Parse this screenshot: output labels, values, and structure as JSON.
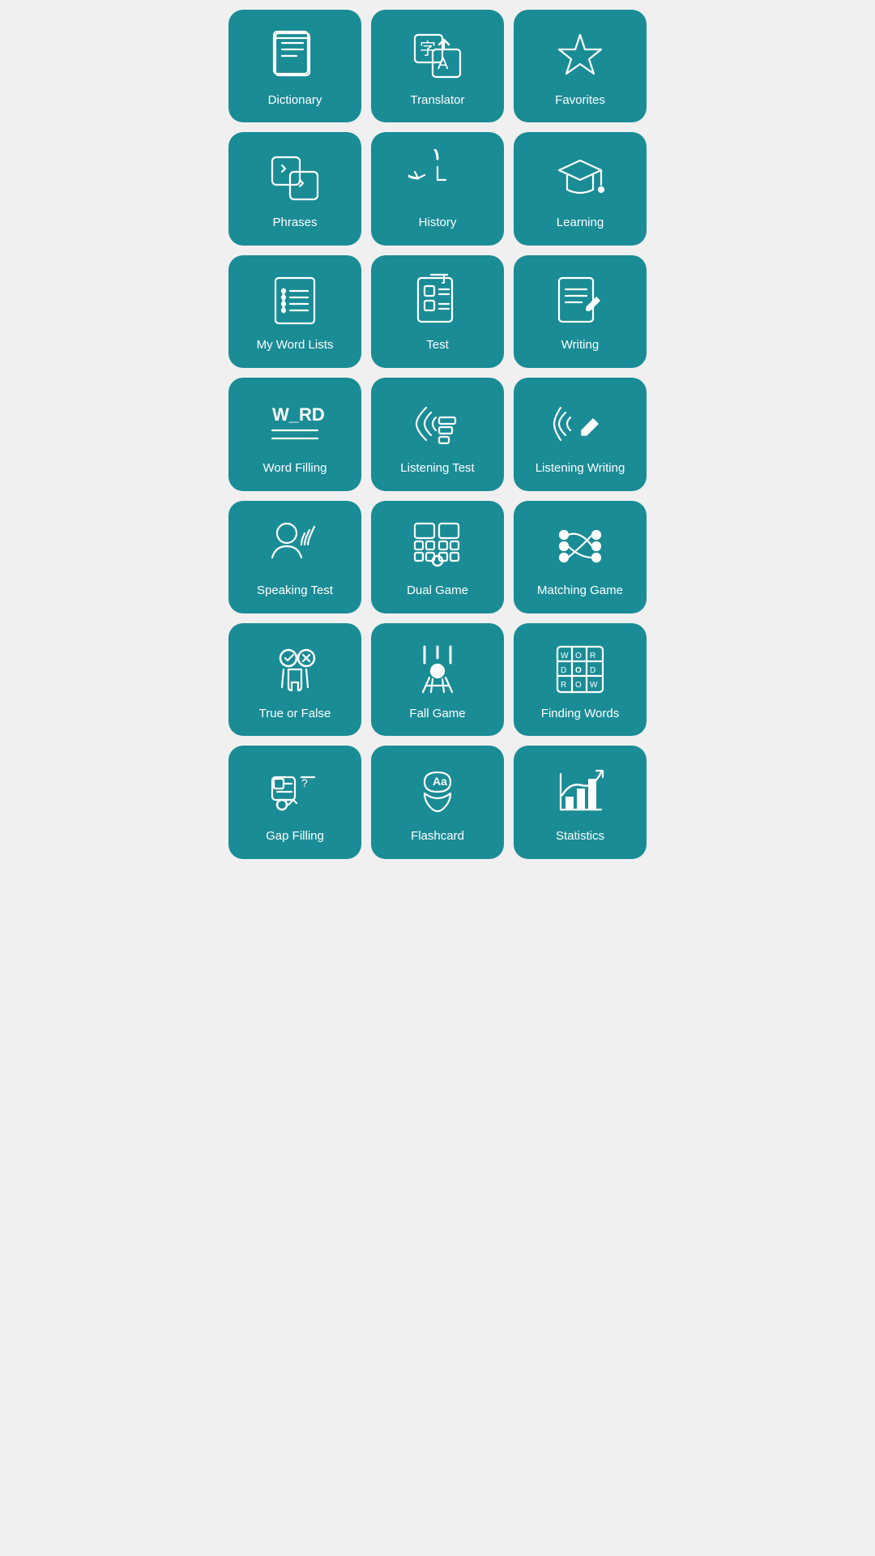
{
  "tiles": [
    {
      "id": "dictionary",
      "label": "Dictionary",
      "icon": "dictionary"
    },
    {
      "id": "translator",
      "label": "Translator",
      "icon": "translator"
    },
    {
      "id": "favorites",
      "label": "Favorites",
      "icon": "favorites"
    },
    {
      "id": "phrases",
      "label": "Phrases",
      "icon": "phrases"
    },
    {
      "id": "history",
      "label": "History",
      "icon": "history"
    },
    {
      "id": "learning",
      "label": "Learning",
      "icon": "learning"
    },
    {
      "id": "my-word-lists",
      "label": "My Word Lists",
      "icon": "wordlists"
    },
    {
      "id": "test",
      "label": "Test",
      "icon": "test"
    },
    {
      "id": "writing",
      "label": "Writing",
      "icon": "writing"
    },
    {
      "id": "word-filling",
      "label": "Word Filling",
      "icon": "wordfilling"
    },
    {
      "id": "listening-test",
      "label": "Listening Test",
      "icon": "listeningtest"
    },
    {
      "id": "listening-writing",
      "label": "Listening Writing",
      "icon": "listeningwriting"
    },
    {
      "id": "speaking-test",
      "label": "Speaking Test",
      "icon": "speakingtest"
    },
    {
      "id": "dual-game",
      "label": "Dual Game",
      "icon": "dualgame"
    },
    {
      "id": "matching-game",
      "label": "Matching Game",
      "icon": "matchinggame"
    },
    {
      "id": "true-or-false",
      "label": "True or False",
      "icon": "trueorfalse"
    },
    {
      "id": "fall-game",
      "label": "Fall Game",
      "icon": "fallgame"
    },
    {
      "id": "finding-words",
      "label": "Finding Words",
      "icon": "findingwords"
    },
    {
      "id": "gap-filling",
      "label": "Gap Filling",
      "icon": "gapfilling"
    },
    {
      "id": "flashcard",
      "label": "Flashcard",
      "icon": "flashcard"
    },
    {
      "id": "statistics",
      "label": "Statistics",
      "icon": "statistics"
    }
  ]
}
